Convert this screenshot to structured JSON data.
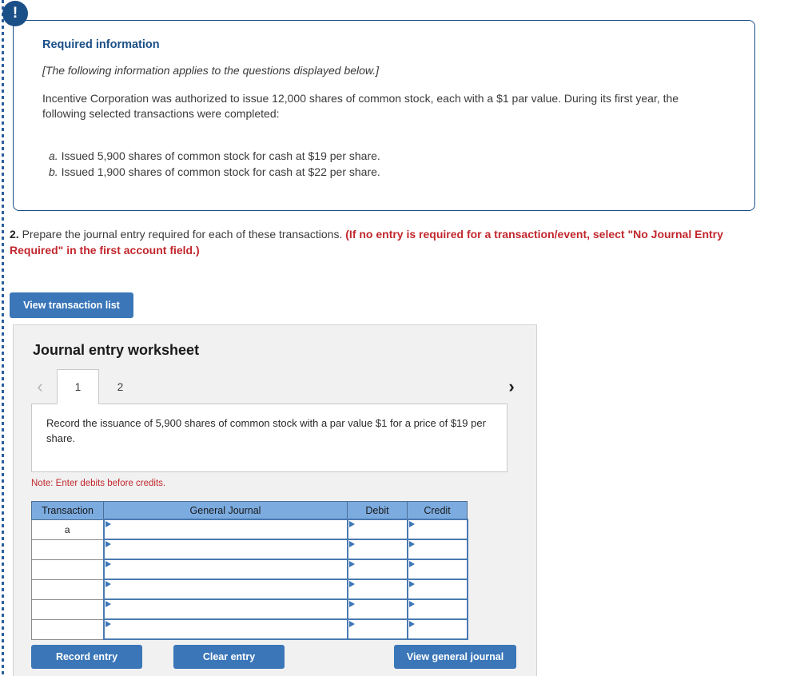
{
  "required_info": {
    "badge_icon": "exclamation-icon",
    "title": "Required information",
    "italic_note": "[The following information applies to the questions displayed below.]",
    "paragraph": "Incentive Corporation was authorized to issue 12,000 shares of common stock, each with a $1 par value. During its first year, the following selected transactions were completed:",
    "items": [
      {
        "label": "a.",
        "text": " Issued 5,900 shares of common stock for cash at $19 per share."
      },
      {
        "label": "b.",
        "text": " Issued 1,900 shares of common stock for cash at $22 per share."
      }
    ]
  },
  "question": {
    "number": "2.",
    "text": " Prepare the journal entry required for each of these transactions. ",
    "bold_red": "(If no entry is required for a transaction/event, select \"No Journal Entry Required\" in the first account field.)"
  },
  "buttons": {
    "view_transaction_list": "View transaction list",
    "record_entry": "Record entry",
    "clear_entry": "Clear entry",
    "view_general_journal": "View general journal"
  },
  "worksheet": {
    "title": "Journal entry worksheet",
    "prev_icon": "chevron-left-icon",
    "next_icon": "chevron-right-icon",
    "tabs": [
      {
        "label": "1",
        "active": true
      },
      {
        "label": "2",
        "active": false
      }
    ],
    "description": "Record the issuance of 5,900 shares of common stock with a par value $1 for a price of $19 per share.",
    "note": "Note: Enter debits before credits.",
    "table": {
      "headers": [
        "Transaction",
        "General Journal",
        "Debit",
        "Credit"
      ],
      "rows": [
        {
          "transaction": "a",
          "general_journal": "",
          "debit": "",
          "credit": ""
        },
        {
          "transaction": "",
          "general_journal": "",
          "debit": "",
          "credit": ""
        },
        {
          "transaction": "",
          "general_journal": "",
          "debit": "",
          "credit": ""
        },
        {
          "transaction": "",
          "general_journal": "",
          "debit": "",
          "credit": ""
        },
        {
          "transaction": "",
          "general_journal": "",
          "debit": "",
          "credit": ""
        },
        {
          "transaction": "",
          "general_journal": "",
          "debit": "",
          "credit": ""
        }
      ]
    }
  },
  "colors": {
    "accent_blue": "#3a76b8",
    "header_blue": "#7cabdf",
    "callout_border": "#1b4f87",
    "alert_red": "#c1272d"
  }
}
